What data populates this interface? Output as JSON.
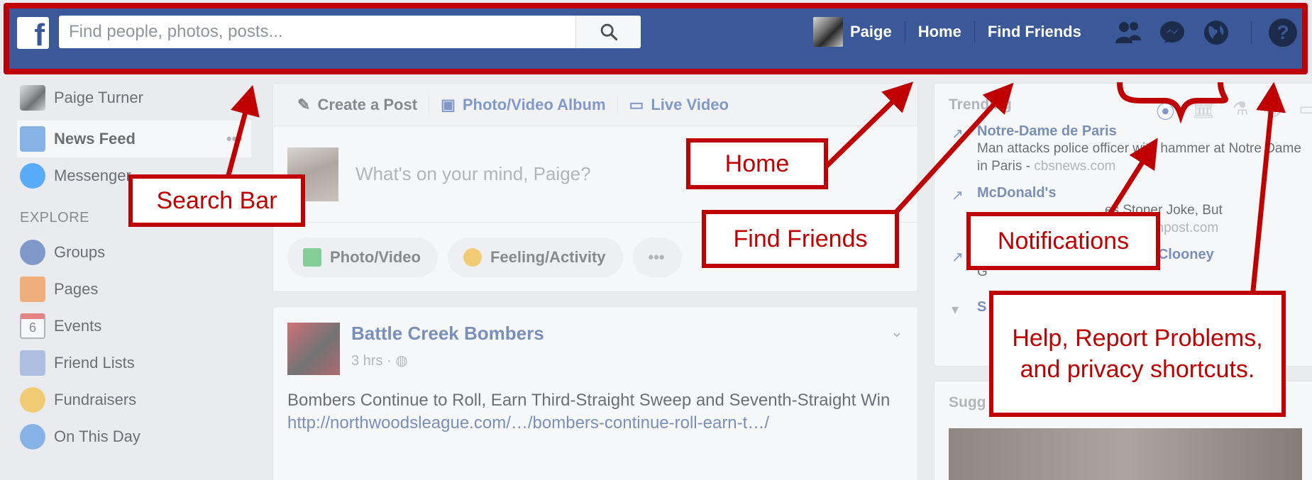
{
  "topbar": {
    "logo_letter": "f",
    "search_placeholder": "Find people, photos, posts...",
    "profile_name": "Paige",
    "home_label": "Home",
    "find_friends_label": "Find Friends"
  },
  "sidebar": {
    "user_name": "Paige Turner",
    "items": [
      {
        "label": "News Feed",
        "active": true
      },
      {
        "label": "Messenger"
      }
    ],
    "explore_heading": "EXPLORE",
    "explore_items": [
      {
        "label": "Groups"
      },
      {
        "label": "Pages"
      },
      {
        "label": "Events",
        "badge": "6"
      },
      {
        "label": "Friend Lists"
      },
      {
        "label": "Fundraisers"
      },
      {
        "label": "On This Day"
      }
    ]
  },
  "composer": {
    "tabs": [
      "Create a Post",
      "Photo/Video Album",
      "Live Video"
    ],
    "placeholder": "What's on your mind, Paige?",
    "actions": [
      "Photo/Video",
      "Feeling/Activity",
      "•••"
    ]
  },
  "post": {
    "author": "Battle Creek Bombers",
    "time": "3 hrs",
    "text": "Bombers Continue to Roll, Earn Third-Straight Sweep and Seventh-Straight Win",
    "link": "http://northwoodsleague.com/…/bombers-continue-roll-earn-t…/"
  },
  "trending": {
    "title": "Trending",
    "items": [
      {
        "name": "Notre-Dame de Paris",
        "desc": "Man attacks police officer with hammer at Notre Dame in Paris",
        "source": "cbsnews.com"
      },
      {
        "name": "McDonald's",
        "desc": "es Stoner Joke, But",
        "source": "huffingtonpost.com"
      },
      {
        "name": "George Clooney and Amal Clooney",
        "desc": "G",
        "source": ""
      }
    ],
    "see_more": "S"
  },
  "suggested": {
    "title": "Sugg"
  },
  "annotations": {
    "search_bar": "Search Bar",
    "home": "Home",
    "find_friends": "Find Friends",
    "notifications": "Notifications",
    "help": "Help, Report Problems, and privacy shortcuts."
  },
  "colors": {
    "brand": "#3b5998",
    "annotation": "#c00000",
    "link": "#365899"
  }
}
